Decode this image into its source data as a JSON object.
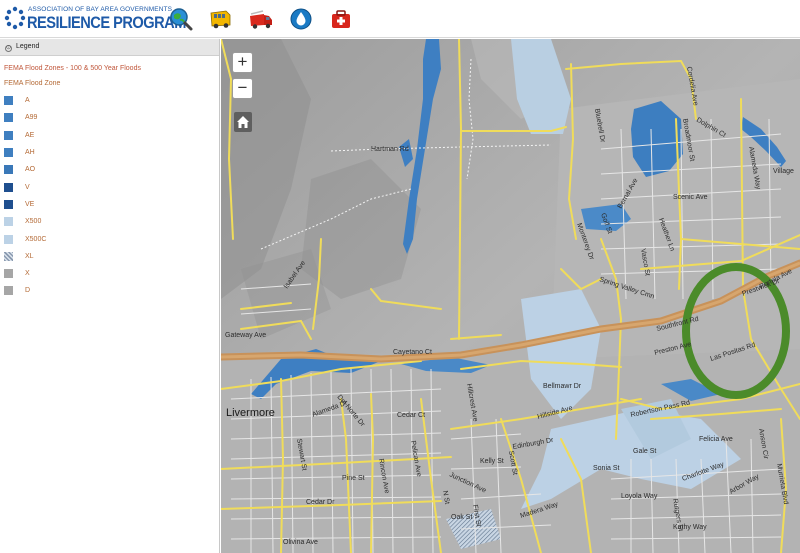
{
  "header": {
    "org_name": "ASSOCIATION OF BAY AREA GOVERNMENTS",
    "program_name": "RESILIENCE PROGRAM",
    "tools": [
      {
        "name": "globe-search-tool",
        "icon": "globe-magnifier-icon"
      },
      {
        "name": "school-bus-tool",
        "icon": "school-bus-icon"
      },
      {
        "name": "fire-truck-tool",
        "icon": "fire-truck-icon"
      },
      {
        "name": "water-drop-tool",
        "icon": "water-drop-icon"
      },
      {
        "name": "first-aid-kit-tool",
        "icon": "first-aid-kit-icon"
      }
    ]
  },
  "legend": {
    "header": "Legend",
    "toggle_glyph": "⊙",
    "layer_title": "FEMA Flood Zones - 100 & 500 Year Floods",
    "layer_subtitle": "FEMA Flood Zone",
    "items": [
      {
        "label": "A",
        "color": "#3f7fc0",
        "pattern": "solid"
      },
      {
        "label": "A99",
        "color": "#3f7fc0",
        "pattern": "solid"
      },
      {
        "label": "AE",
        "color": "#3f7fc0",
        "pattern": "solid"
      },
      {
        "label": "AH",
        "color": "#3f7fc0",
        "pattern": "solid"
      },
      {
        "label": "AO",
        "color": "#3a78b8",
        "pattern": "solid"
      },
      {
        "label": "V",
        "color": "#1f4f8f",
        "pattern": "solid"
      },
      {
        "label": "VE",
        "color": "#1f4f8f",
        "pattern": "solid"
      },
      {
        "label": "X500",
        "color": "#bcd2e6",
        "pattern": "solid"
      },
      {
        "label": "X500C",
        "color": "#bcd2e6",
        "pattern": "solid"
      },
      {
        "label": "XL",
        "color": "#8a9ab0",
        "pattern": "hatched"
      },
      {
        "label": "X",
        "color": "#a6a6a6",
        "pattern": "solid"
      },
      {
        "label": "D",
        "color": "#a6a6a6",
        "pattern": "solid"
      }
    ]
  },
  "map_controls": {
    "zoom_in": "+",
    "zoom_out": "−",
    "home": "home-icon"
  },
  "map_labels": {
    "hartman_rd": "Hartman Rd",
    "scenic_ave": "Scenic Ave",
    "village": "Village",
    "portola_ave": "Portola Ave",
    "isabel_ave": "Isabel Ave",
    "gateway_ave": "Gateway Ave",
    "cayetano_ct": "Cayetano Ct",
    "bellmawr_dr": "Bellmawr Dr",
    "livermore": "Livermore",
    "alameda_dr": "Alameda Dr",
    "del_norte_dr": "Del Norte Dr",
    "rincon_ave": "Rincon Ave",
    "pine_st": "Pine St",
    "cedar_dr": "Cedar Dr",
    "olivina_ave": "Olivina Ave",
    "junction_ave": "Junction Ave",
    "kelly_st": "Kelly St",
    "edinburgh_dr": "Edinburgh Dr",
    "hillside_ave": "Hillside Ave",
    "scott_st": "Scott St",
    "madera_way": "Madera Way",
    "oak_st": "Oak St",
    "gale_st": "Gale St",
    "sonia_st": "Sonia St",
    "loyola_way": "Loyola Way",
    "rutgers_st": "Rutgers St",
    "charlotte_way": "Charlotte Way",
    "kathy_way": "Kathy Way",
    "felicia_ave": "Felicia Ave",
    "arbor_way": "Arbor Way",
    "murrieta_blvd": "Murrieta Blvd",
    "anson_cir": "Anson Cir",
    "las_positas_rd": "Las Positas Rd",
    "prestwick_dr": "Prestwick Dr",
    "southfront_rd": "Southfront Rd",
    "preston_ave": "Preston Ave",
    "robertson_pass_rd": "Robertson Pass Rd",
    "hillcrest_ave": "Hillcrest Ave",
    "spring_valley_cmn": "Spring Valley Cmn",
    "monterey_dr": "Monterey Dr",
    "bluebell_dr": "Bluebell Dr",
    "golf_st": "Golf St",
    "heather_ln": "Heather Ln",
    "alameda_way": "Alameda Way",
    "dolphin_ct": "Dolphin Ct",
    "bernal_ave": "Bernal Ave",
    "broadmoor_st": "Broadmoor St",
    "cordelia_ave": "Cordelia Ave",
    "vasco_st": "Vasco St",
    "stewart_st": "Stewart St",
    "pelican_ave": "Pelican Ave",
    "first_st": "First St",
    "n_st": "N St",
    "cedar_ct": "Cedar Ct"
  },
  "highlight_ring_color": "#4b8b2a"
}
